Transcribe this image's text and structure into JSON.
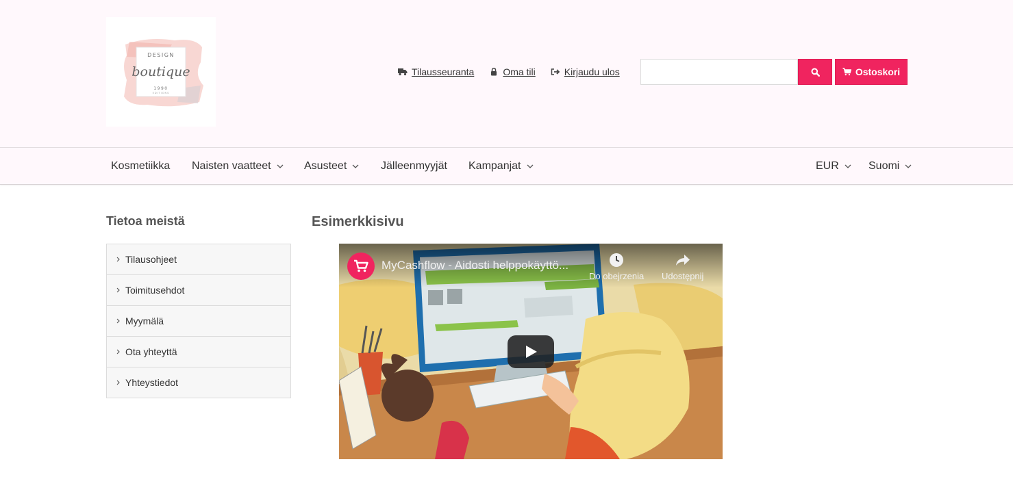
{
  "header": {
    "logo": {
      "line1": "DESIGN",
      "line2": "boutique",
      "line3": "1990",
      "line4": "EDITIONS"
    },
    "links": [
      {
        "label": "Tilausseuranta",
        "icon": "truck-icon"
      },
      {
        "label": "Oma tili",
        "icon": "lock-icon"
      },
      {
        "label": "Kirjaudu ulos",
        "icon": "sign-out-icon"
      }
    ],
    "search": {
      "value": "",
      "placeholder": ""
    },
    "cart_label": "Ostoskori"
  },
  "nav": {
    "items": [
      {
        "label": "Kosmetiikka",
        "dropdown": false
      },
      {
        "label": "Naisten vaatteet",
        "dropdown": true
      },
      {
        "label": "Asusteet",
        "dropdown": true
      },
      {
        "label": "Jälleenmyyjät",
        "dropdown": false
      },
      {
        "label": "Kampanjat",
        "dropdown": true
      }
    ],
    "currency": "EUR",
    "language": "Suomi"
  },
  "sidebar": {
    "title": "Tietoa meistä",
    "items": [
      {
        "label": "Tilausohjeet"
      },
      {
        "label": "Toimitusehdot"
      },
      {
        "label": "Myymälä"
      },
      {
        "label": "Ota yhteyttä"
      },
      {
        "label": "Yhteystiedot"
      }
    ]
  },
  "main": {
    "title": "Esimerkkisivu",
    "video": {
      "title": "MyCashflow - Aidosti helppokäyttö...",
      "watch_later": "Do obejrzenia",
      "share": "Udostępnij"
    }
  },
  "colors": {
    "accent": "#f0245f",
    "header_bg": "#fff8fc"
  }
}
